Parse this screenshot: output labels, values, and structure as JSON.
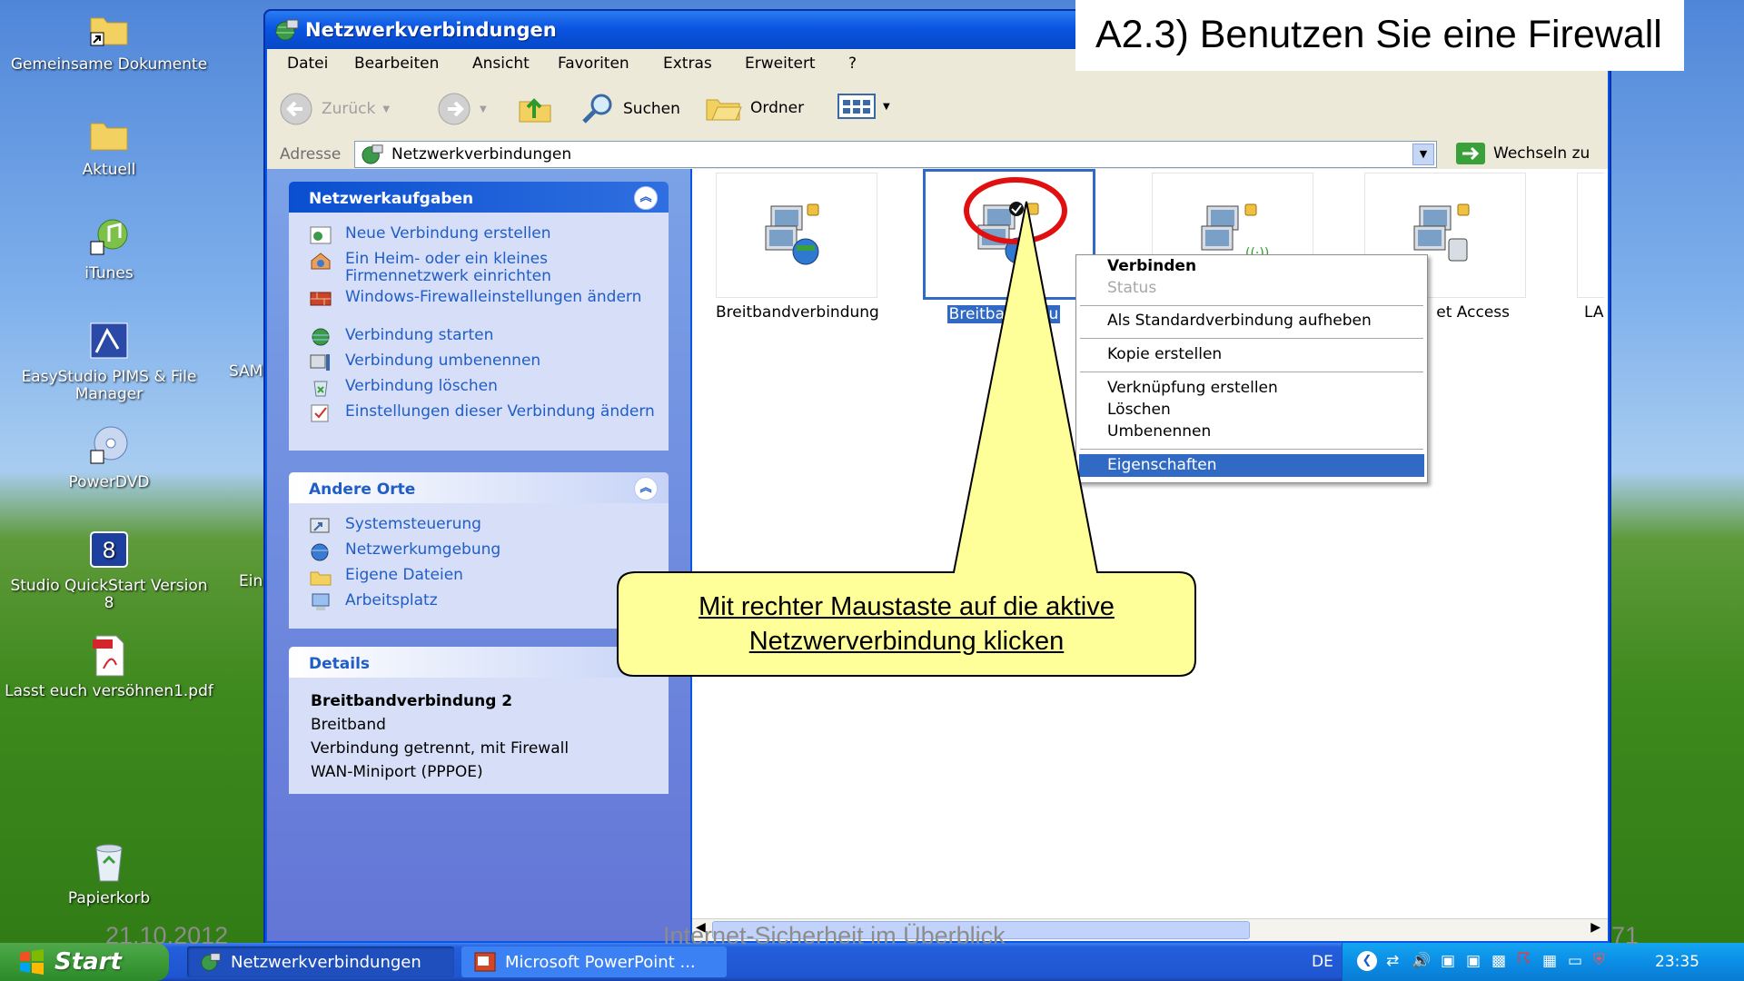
{
  "slide": {
    "title": "A2.3) Benutzen Sie eine Firewall",
    "callout_line1": "Mit rechter Maustaste auf die aktive",
    "callout_line2": "Netzwerverbindung klicken",
    "date": "21.10.2012",
    "footer": "Internet-Sicherheit im Überblick",
    "page": "71"
  },
  "desktop": {
    "icons": [
      {
        "label": "Gemeinsame Dokumente",
        "icon": "folder-shortcut-icon"
      },
      {
        "label": "Aktuell",
        "icon": "folder-icon"
      },
      {
        "label": "iTunes",
        "icon": "itunes-icon"
      },
      {
        "label": "EasyStudio PIMS & File Manager",
        "icon": "easystudio-icon"
      },
      {
        "label": "PowerDVD",
        "icon": "powerdvd-icon"
      },
      {
        "label": "Studio QuickStart Version 8",
        "icon": "studio-quickstart-icon"
      },
      {
        "label": "Lasst euch versöhnen1.pdf",
        "icon": "pdf-file-icon"
      },
      {
        "label": "Papierkorb",
        "icon": "recycle-bin-icon"
      }
    ],
    "clipped": [
      "SAM",
      "Ein"
    ]
  },
  "window": {
    "title": "Netzwerkverbindungen",
    "menu": [
      "Datei",
      "Bearbeiten",
      "Ansicht",
      "Favoriten",
      "Extras",
      "Erweitert",
      "?"
    ],
    "toolbar": {
      "back": "Zurück",
      "search": "Suchen",
      "folders": "Ordner"
    },
    "address": {
      "label": "Adresse",
      "value": "Netzwerkverbindungen",
      "go": "Wechseln zu"
    },
    "network_tasks": {
      "title": "Netzwerkaufgaben",
      "items": [
        "Neue Verbindung erstellen",
        "Ein Heim- oder ein kleines Firmennetzwerk einrichten",
        "Windows-Firewalleinstellungen ändern",
        "Verbindung starten",
        "Verbindung umbenennen",
        "Verbindung löschen",
        "Einstellungen dieser Verbindung ändern"
      ]
    },
    "other_places": {
      "title": "Andere Orte",
      "items": [
        "Systemsteuerung",
        "Netzwerkumgebung",
        "Eigene Dateien",
        "Arbeitsplatz"
      ]
    },
    "details": {
      "title": "Details",
      "name": "Breitbandverbindung 2",
      "type": "Breitband",
      "status": "Verbindung getrennt, mit Firewall",
      "device": "WAN-Miniport (PPPOE)"
    },
    "connections": [
      {
        "label": "Breitbandverbindung"
      },
      {
        "label": "Breitband   ndu"
      },
      {
        "label": ""
      },
      {
        "label": "et Access"
      },
      {
        "label": "LA"
      }
    ]
  },
  "context_menu": {
    "items": [
      {
        "label": "Verbinden",
        "state": "default"
      },
      {
        "label": "Status",
        "state": "disabled"
      },
      {
        "label": "Als Standardverbindung aufheben",
        "state": "normal"
      },
      {
        "label": "Kopie erstellen",
        "state": "normal"
      },
      {
        "label": "Verknüpfung erstellen",
        "state": "normal"
      },
      {
        "label": "Löschen",
        "state": "normal"
      },
      {
        "label": "Umbenennen",
        "state": "normal"
      },
      {
        "label": "Eigenschaften",
        "state": "highlighted"
      }
    ]
  },
  "taskbar": {
    "start": "Start",
    "tasks": [
      "Netzwerkverbindungen",
      "Microsoft PowerPoint ..."
    ],
    "language": "DE",
    "clock": "23:35"
  }
}
